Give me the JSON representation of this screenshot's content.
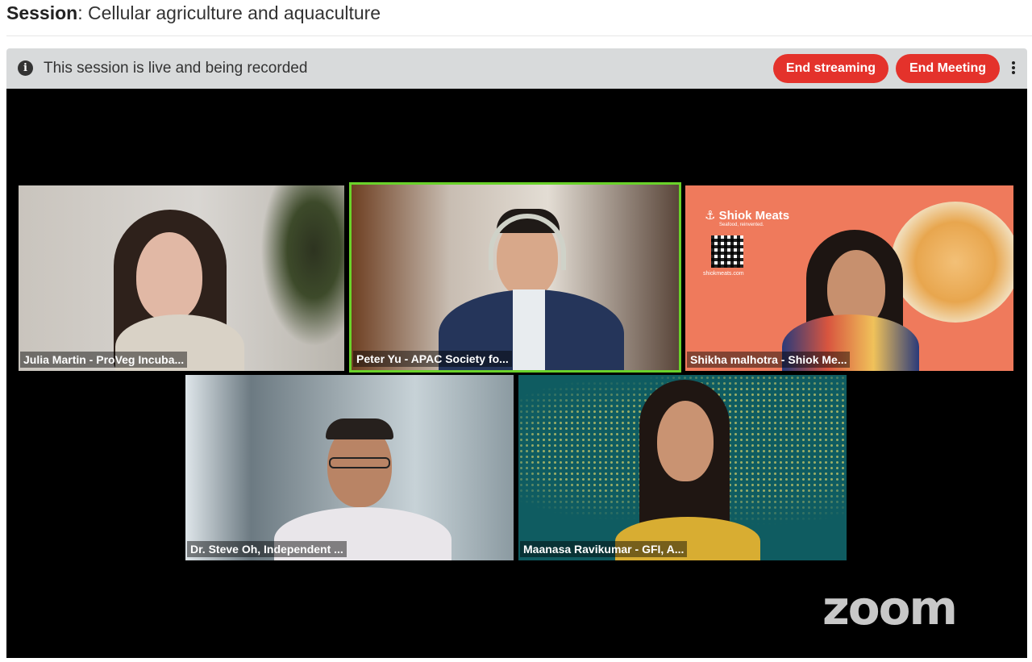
{
  "header": {
    "session_label": "Session",
    "session_title": ": Cellular agriculture and aquaculture"
  },
  "banner": {
    "icon": "info-icon",
    "message": "This session is live and being recorded",
    "end_streaming_label": "End streaming",
    "end_meeting_label": "End Meeting",
    "more_icon": "kebab-menu-icon",
    "button_color": "#e4322b"
  },
  "video": {
    "active_speaker_color": "#6ad22a",
    "brand_logo": "zoom",
    "participants": [
      {
        "name": "Julia Martin - ProVeg Incuba..."
      },
      {
        "name": "Peter Yu - APAC Society fo...",
        "active": true
      },
      {
        "name": "Shikha malhotra - Shiok Me..."
      },
      {
        "name": "Dr. Steve Oh, Independent ..."
      },
      {
        "name": "Maanasa Ravikumar - GFI, A..."
      }
    ],
    "shiok_brand": "Shiok Meats",
    "shiok_tagline": "Seafood, reinvented.",
    "shiok_url": "shiokmeats.com"
  }
}
